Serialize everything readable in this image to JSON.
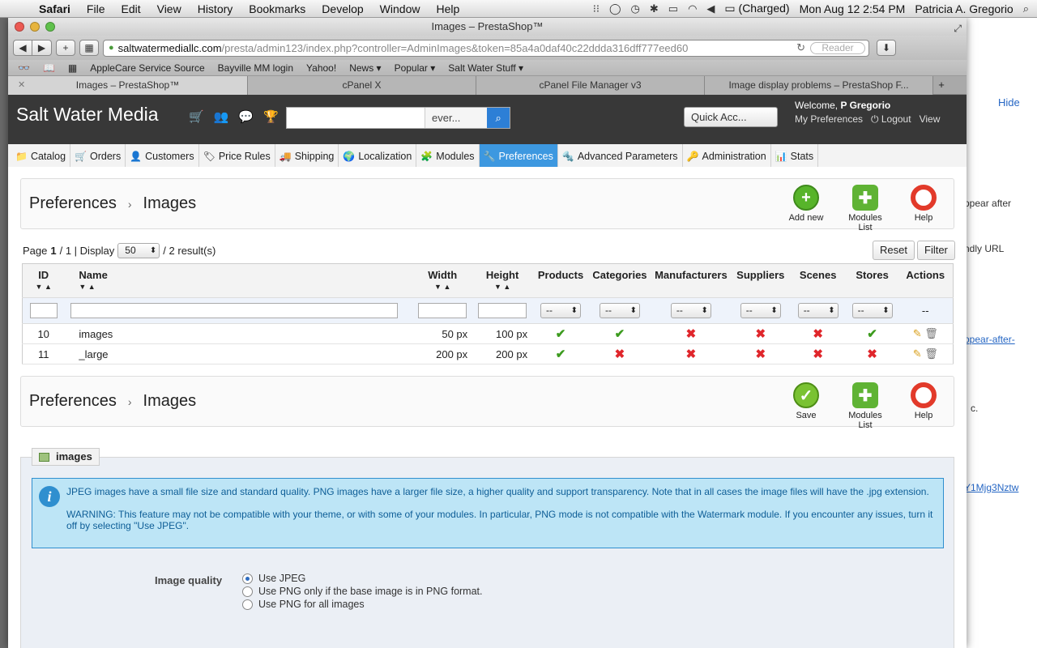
{
  "menubar": {
    "apple": "",
    "app": "Safari",
    "items": [
      "File",
      "Edit",
      "View",
      "History",
      "Bookmarks",
      "Develop",
      "Window",
      "Help"
    ],
    "battery": "(Charged)",
    "clock": "Mon Aug 12  2:54 PM",
    "user": "Patricia A. Gregorio"
  },
  "window": {
    "title": "Images – PrestaShop™"
  },
  "urlbar": {
    "host": "saltwatermediallc.com",
    "path": "/presta/admin123/index.php?controller=AdminImages&token=85a4a0daf40c22ddda316dff777eed60",
    "reader": "Reader"
  },
  "bookmarks": [
    "AppleCare Service Source",
    "Bayville MM login",
    "Yahoo!",
    "News ▾",
    "Popular ▾",
    "Salt Water Stuff ▾"
  ],
  "tabs": [
    {
      "label": "Images – PrestaShop™"
    },
    {
      "label": "cPanel X"
    },
    {
      "label": "cPanel File Manager v3"
    },
    {
      "label": "Image display problems – PrestaShop F..."
    }
  ],
  "header": {
    "brand": "Salt Water Media",
    "search_select": "ever...",
    "quick_access": "Quick Acc...",
    "welcome_prefix": "Welcome, ",
    "user": "P Gregorio",
    "my_prefs": "My Preferences",
    "logout": "Logout",
    "view": "View"
  },
  "nav": [
    {
      "label": "Catalog",
      "icon": "📁"
    },
    {
      "label": "Orders",
      "icon": "🛒"
    },
    {
      "label": "Customers",
      "icon": "👤"
    },
    {
      "label": "Price Rules",
      "icon": "🏷"
    },
    {
      "label": "Shipping",
      "icon": "🚚"
    },
    {
      "label": "Localization",
      "icon": "🌍"
    },
    {
      "label": "Modules",
      "icon": "🧩"
    },
    {
      "label": "Preferences",
      "icon": "🔧"
    },
    {
      "label": "Advanced Parameters",
      "icon": "🔩"
    },
    {
      "label": "Administration",
      "icon": "🔑"
    },
    {
      "label": "Stats",
      "icon": "📊"
    }
  ],
  "toolbar1": {
    "crumb1": "Preferences",
    "crumb2": "Images",
    "add_new": "Add new",
    "modules_list": "Modules List",
    "help": "Help"
  },
  "pager": {
    "page_label": "Page",
    "page": "1",
    "total": "/ 1 | Display",
    "display": "50",
    "results": "/ 2 result(s)",
    "reset": "Reset",
    "filter": "Filter"
  },
  "table": {
    "headers": [
      "ID",
      "Name",
      "Width",
      "Height",
      "Products",
      "Categories",
      "Manufacturers",
      "Suppliers",
      "Scenes",
      "Stores",
      "Actions"
    ],
    "select_placeholder": "--",
    "actions_dash": "--",
    "rows": [
      {
        "id": "10",
        "name": "images",
        "width": "50 px",
        "height": "100 px",
        "flags": [
          "yes",
          "yes",
          "no",
          "no",
          "no",
          "yes"
        ]
      },
      {
        "id": "11",
        "name": "_large",
        "width": "200 px",
        "height": "200 px",
        "flags": [
          "yes",
          "no",
          "no",
          "no",
          "no",
          "no"
        ]
      }
    ]
  },
  "toolbar2": {
    "crumb1": "Preferences",
    "crumb2": "Images",
    "save": "Save",
    "modules_list": "Modules List",
    "help": "Help"
  },
  "fieldset": {
    "legend": "images",
    "hint1": "JPEG images have a small file size and standard quality. PNG images have a larger file size, a higher quality and support transparency. Note that in all cases the image files will have the .jpg extension.",
    "hint2": "WARNING: This feature may not be compatible with your theme, or with some of your modules. In particular, PNG mode is not compatible with the Watermark module. If you encounter any issues, turn it off by selecting \"Use JPEG\".",
    "quality_label": "Image quality",
    "options": [
      "Use JPEG",
      "Use PNG only if the base image is in PNG format.",
      "Use PNG for all images"
    ],
    "selected": 0
  },
  "background_window": {
    "hide": "Hide",
    "snippets": [
      "ppear after",
      "ndly URL",
      "ppear-after-",
      "c.",
      "Y1Mjg3Nztw"
    ]
  },
  "colors": {
    "header_bg": "#383838",
    "nav_active": "#3d98e0",
    "hint_bg": "#bde5f6"
  }
}
